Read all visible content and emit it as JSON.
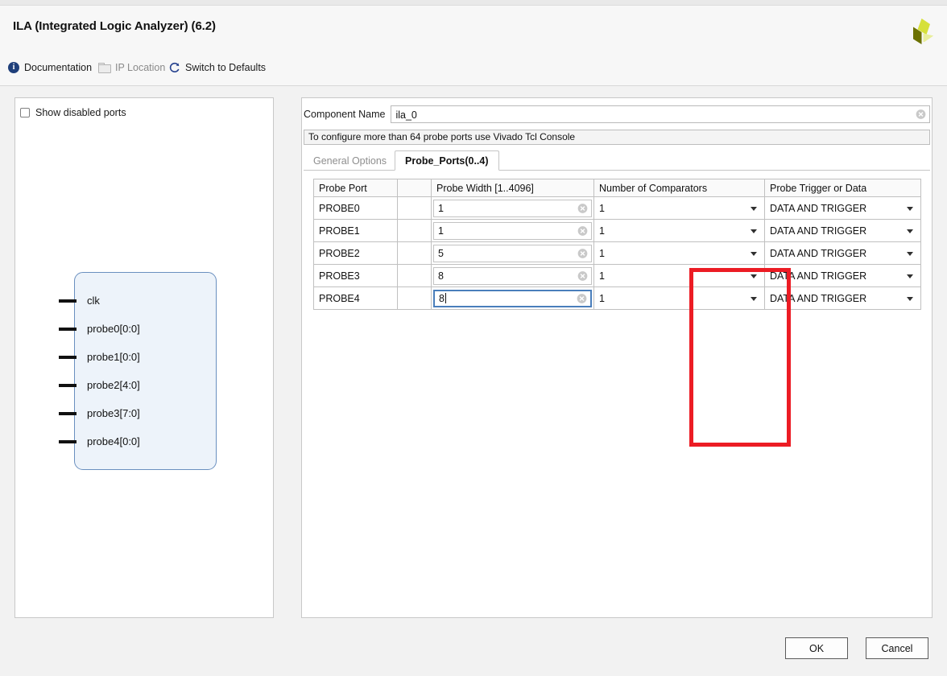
{
  "window": {
    "title": "ILA (Integrated Logic Analyzer) (6.2)",
    "logo_name": "xilinx-logo"
  },
  "toolbar": {
    "documentation": "Documentation",
    "ip_location": "IP Location",
    "switch_to_defaults": "Switch to Defaults"
  },
  "left_panel": {
    "show_disabled_ports_label": "Show disabled ports",
    "show_disabled_ports_checked": false,
    "block_ports": [
      "clk",
      "probe0[0:0]",
      "probe1[0:0]",
      "probe2[4:0]",
      "probe3[7:0]",
      "probe4[0:0]"
    ]
  },
  "right_panel": {
    "component_name_label": "Component Name",
    "component_name_value": "ila_0",
    "warning_message": "To configure more than 64 probe ports use Vivado Tcl Console",
    "tabs": [
      {
        "label": "General Options",
        "active": false
      },
      {
        "label": "Probe_Ports(0..4)",
        "active": true
      }
    ],
    "table": {
      "headers": [
        "Probe Port",
        "",
        "Probe Width [1..4096]",
        "Number of Comparators",
        "Probe Trigger or Data"
      ],
      "rows": [
        {
          "port": "PROBE0",
          "width": "1",
          "comparators": "1",
          "trigger": "DATA AND TRIGGER",
          "focused": false
        },
        {
          "port": "PROBE1",
          "width": "1",
          "comparators": "1",
          "trigger": "DATA AND TRIGGER",
          "focused": false
        },
        {
          "port": "PROBE2",
          "width": "5",
          "comparators": "1",
          "trigger": "DATA AND TRIGGER",
          "focused": false
        },
        {
          "port": "PROBE3",
          "width": "8",
          "comparators": "1",
          "trigger": "DATA AND TRIGGER",
          "focused": false
        },
        {
          "port": "PROBE4",
          "width": "8",
          "comparators": "1",
          "trigger": "DATA AND TRIGGER",
          "focused": true
        }
      ]
    }
  },
  "footer": {
    "ok": "OK",
    "cancel": "Cancel"
  },
  "colors": {
    "annotation_red": "#ec1c24",
    "focus_blue": "#4a7ebb",
    "logo_bright": "#d6e03a",
    "logo_dark": "#6b7000",
    "logo_pale": "#e8ee9a"
  }
}
